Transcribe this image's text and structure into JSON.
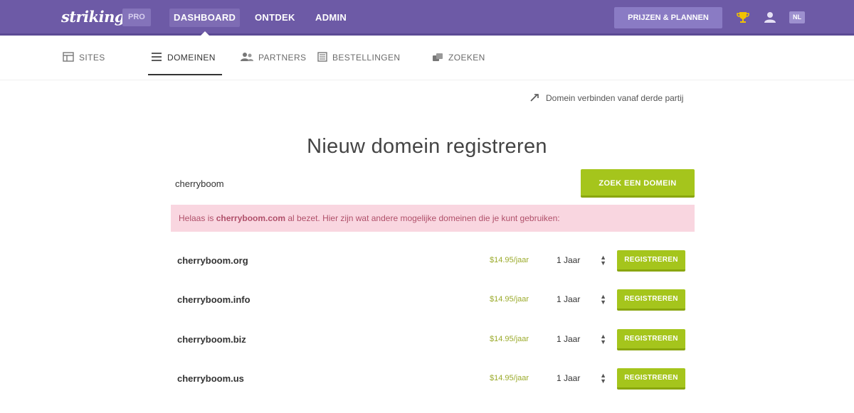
{
  "header": {
    "logo": "strikingly",
    "plan_badge": "PRO",
    "nav": [
      "DASHBOARD",
      "ONTDEK",
      "ADMIN"
    ],
    "upgrade_label": "PRIJZEN & PLANNEN",
    "lang_badge": "NL"
  },
  "subnav": {
    "items": [
      {
        "label": "SITES",
        "icon": "sites-icon"
      },
      {
        "label": "DOMEINEN",
        "icon": "domains-icon"
      },
      {
        "label": "PARTNERS",
        "icon": "partners-icon"
      },
      {
        "label": "BESTELLINGEN",
        "icon": "orders-icon"
      },
      {
        "label": "ZOEKEN",
        "icon": "search-icon"
      }
    ],
    "active_index": 1
  },
  "connect_link": "Domein verbinden vanaf derde partij",
  "title": "Nieuw domein registreren",
  "search": {
    "value": "cherryboom",
    "button_label": "ZOEK EEN DOMEIN"
  },
  "alert": {
    "prefix": "Helaas is ",
    "domain": "cherryboom.com",
    "suffix": " al bezet. Hier zijn wat andere mogelijke domeinen die je kunt gebruiken:"
  },
  "domains": [
    {
      "name": "cherryboom.org",
      "price": "$14.95/jaar",
      "years": "1 Jaar",
      "button": "REGISTREREN"
    },
    {
      "name": "cherryboom.info",
      "price": "$14.95/jaar",
      "years": "1 Jaar",
      "button": "REGISTREREN"
    },
    {
      "name": "cherryboom.biz",
      "price": "$14.95/jaar",
      "years": "1 Jaar",
      "button": "REGISTREREN"
    },
    {
      "name": "cherryboom.us",
      "price": "$14.95/jaar",
      "years": "1 Jaar",
      "button": "REGISTREREN"
    }
  ],
  "colors": {
    "header_bg": "#6d5aa6",
    "accent_green": "#a5c51c",
    "alert_bg": "#f9d6e0"
  }
}
